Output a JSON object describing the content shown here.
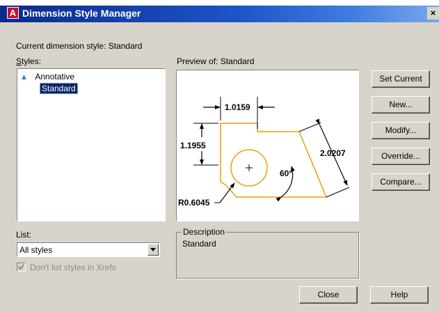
{
  "window": {
    "title": "Dimension Style Manager",
    "close_glyph": "×",
    "app_icon_letter": "A"
  },
  "current_style": {
    "label": "Current dimension style: Standard"
  },
  "styles": {
    "label": "Styles:",
    "items": [
      {
        "label": "Annotative",
        "icon": "annotative-triangle-icon",
        "selected": false
      },
      {
        "label": "Standard",
        "selected": true
      }
    ]
  },
  "preview": {
    "label": "Preview of: Standard",
    "dims": {
      "horizontal": "1.0159",
      "vertical": "1.1955",
      "aligned": "2.0207",
      "angle": "60°",
      "radius": "R0.6045"
    }
  },
  "buttons": {
    "set_current": "Set Current",
    "new": "New...",
    "modify": "Modify...",
    "override": "Override...",
    "compare": "Compare...",
    "close": "Close",
    "help": "Help"
  },
  "list": {
    "label": "List:",
    "selected": "All styles"
  },
  "xrefs_checkbox": {
    "label": "Don't list styles in Xrefs",
    "checked": true,
    "enabled": false
  },
  "description": {
    "label": "Description",
    "text": "Standard"
  },
  "colors": {
    "title_start": "#0a2a8c",
    "title_end": "#7aa7eb",
    "selection": "#0a246a",
    "part_outline": "#e8a000",
    "face": "#d8d4cb"
  }
}
